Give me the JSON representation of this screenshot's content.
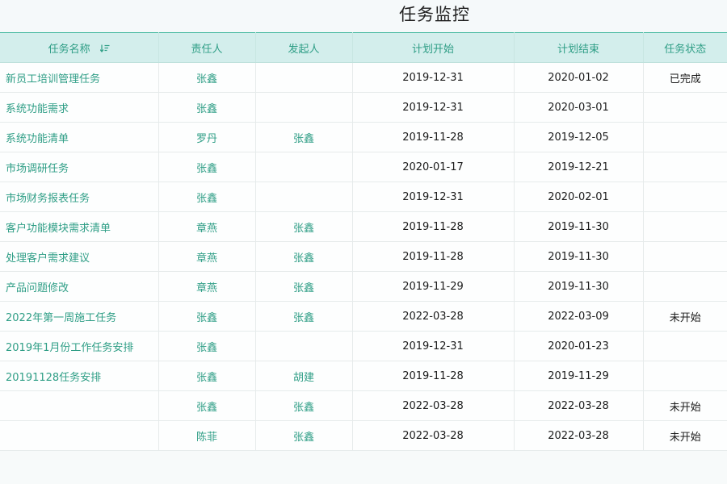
{
  "page": {
    "title": "任务监控"
  },
  "colors": {
    "accent": "#2f9e86",
    "header_bg": "#d3eeec"
  },
  "table": {
    "headers": {
      "name": "任务名称",
      "owner": "责任人",
      "initiator": "发起人",
      "plan_start": "计划开始",
      "plan_end": "计划结束",
      "status": "任务状态"
    },
    "sort_icon": "sort-descending-icon",
    "rows": [
      {
        "name": "新员工培训管理任务",
        "owner": "张鑫",
        "initiator": "",
        "plan_start": "2019-12-31",
        "plan_end": "2020-01-02",
        "status": "已完成"
      },
      {
        "name": "系统功能需求",
        "owner": "张鑫",
        "initiator": "",
        "plan_start": "2019-12-31",
        "plan_end": "2020-03-01",
        "status": ""
      },
      {
        "name": "系统功能清单",
        "owner": "罗丹",
        "initiator": "张鑫",
        "plan_start": "2019-11-28",
        "plan_end": "2019-12-05",
        "status": ""
      },
      {
        "name": "市场调研任务",
        "owner": "张鑫",
        "initiator": "",
        "plan_start": "2020-01-17",
        "plan_end": "2019-12-21",
        "status": ""
      },
      {
        "name": "市场财务报表任务",
        "owner": "张鑫",
        "initiator": "",
        "plan_start": "2019-12-31",
        "plan_end": "2020-02-01",
        "status": ""
      },
      {
        "name": "客户功能模块需求清单",
        "owner": "章燕",
        "initiator": "张鑫",
        "plan_start": "2019-11-28",
        "plan_end": "2019-11-30",
        "status": ""
      },
      {
        "name": "处理客户需求建议",
        "owner": "章燕",
        "initiator": "张鑫",
        "plan_start": "2019-11-28",
        "plan_end": "2019-11-30",
        "status": ""
      },
      {
        "name": "产品问题修改",
        "owner": "章燕",
        "initiator": "张鑫",
        "plan_start": "2019-11-29",
        "plan_end": "2019-11-30",
        "status": ""
      },
      {
        "name": "2022年第一周施工任务",
        "owner": "张鑫",
        "initiator": "张鑫",
        "plan_start": "2022-03-28",
        "plan_end": "2022-03-09",
        "status": "未开始"
      },
      {
        "name": "2019年1月份工作任务安排",
        "owner": "张鑫",
        "initiator": "",
        "plan_start": "2019-12-31",
        "plan_end": "2020-01-23",
        "status": ""
      },
      {
        "name": "20191128任务安排",
        "owner": "张鑫",
        "initiator": "胡建",
        "plan_start": "2019-11-28",
        "plan_end": "2019-11-29",
        "status": ""
      },
      {
        "name": "",
        "owner": "张鑫",
        "initiator": "张鑫",
        "plan_start": "2022-03-28",
        "plan_end": "2022-03-28",
        "status": "未开始"
      },
      {
        "name": "",
        "owner": "陈菲",
        "initiator": "张鑫",
        "plan_start": "2022-03-28",
        "plan_end": "2022-03-28",
        "status": "未开始"
      }
    ]
  }
}
